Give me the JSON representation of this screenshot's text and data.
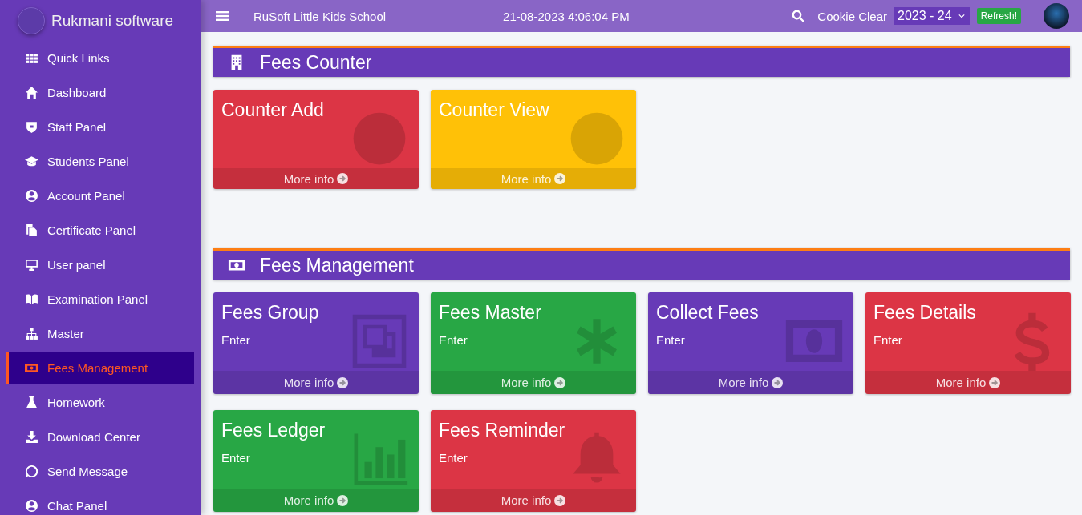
{
  "brand": {
    "name": "Rukmani software"
  },
  "sidebar": {
    "items": [
      {
        "label": "Quick Links",
        "selected": false
      },
      {
        "label": "Dashboard",
        "selected": false
      },
      {
        "label": "Staff Panel",
        "selected": false
      },
      {
        "label": "Students Panel",
        "selected": false
      },
      {
        "label": "Account Panel",
        "selected": false
      },
      {
        "label": "Certificate Panel",
        "selected": false
      },
      {
        "label": "User panel",
        "selected": false
      },
      {
        "label": "Examination Panel",
        "selected": false
      },
      {
        "label": "Master",
        "selected": false
      },
      {
        "label": "Fees Management",
        "selected": true
      },
      {
        "label": "Homework",
        "selected": false
      },
      {
        "label": "Download Center",
        "selected": false
      },
      {
        "label": "Send Message",
        "selected": false
      },
      {
        "label": "Chat Panel",
        "selected": false
      }
    ]
  },
  "topbar": {
    "school": "RuSoft Little Kids School",
    "datetime": "21-08-2023 4:06:04 PM",
    "cookie": "Cookie Clear",
    "year": "2023 - 24",
    "refresh": "Refresh!"
  },
  "sections": [
    {
      "title": "Fees Counter",
      "cards": [
        {
          "title": "Counter Add",
          "color": "#dc3545",
          "footer": "More info"
        },
        {
          "title": "Counter View",
          "color": "#ffc107",
          "footer": "More info"
        }
      ]
    },
    {
      "title": "Fees Management",
      "cards": [
        {
          "title": "Fees Group",
          "subtitle": "Enter",
          "color": "#673ab7",
          "footer": "More info"
        },
        {
          "title": "Fees Master",
          "subtitle": "Enter",
          "color": "#28a745",
          "footer": "More info"
        },
        {
          "title": "Collect Fees",
          "subtitle": "Enter",
          "color": "#673ab7",
          "footer": "More info"
        },
        {
          "title": "Fees Details",
          "subtitle": "Enter",
          "color": "#dc3545",
          "footer": "More info"
        },
        {
          "title": "Fees Ledger",
          "subtitle": "Enter",
          "color": "#28a745",
          "footer": "More info"
        },
        {
          "title": "Fees Reminder",
          "subtitle": "Enter",
          "color": "#dc3545",
          "footer": "More info"
        }
      ]
    }
  ]
}
